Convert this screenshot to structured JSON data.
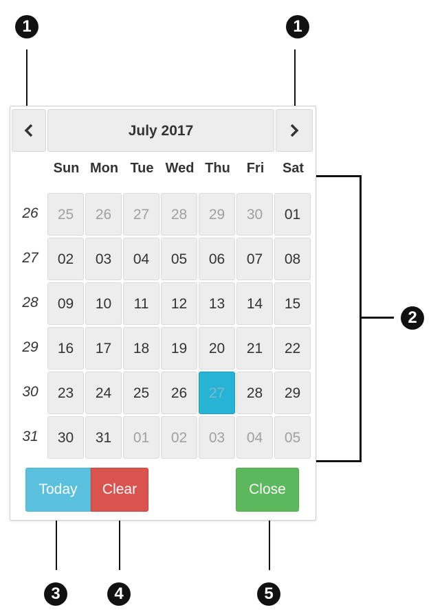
{
  "callouts": {
    "prev": "1",
    "next": "1",
    "grid": "2",
    "today": "3",
    "clear": "4",
    "close": "5"
  },
  "picker": {
    "title": "July 2017",
    "prev_icon": "chevron-left-icon",
    "next_icon": "chevron-right-icon",
    "weekdays": [
      "Sun",
      "Mon",
      "Tue",
      "Wed",
      "Thu",
      "Fri",
      "Sat"
    ],
    "weeks": [
      {
        "num": "26",
        "days": [
          "25",
          "26",
          "27",
          "28",
          "29",
          "30",
          "01"
        ]
      },
      {
        "num": "27",
        "days": [
          "02",
          "03",
          "04",
          "05",
          "06",
          "07",
          "08"
        ]
      },
      {
        "num": "28",
        "days": [
          "09",
          "10",
          "11",
          "12",
          "13",
          "14",
          "15"
        ]
      },
      {
        "num": "29",
        "days": [
          "16",
          "17",
          "18",
          "19",
          "20",
          "21",
          "22"
        ]
      },
      {
        "num": "30",
        "days": [
          "23",
          "24",
          "25",
          "26",
          "27",
          "28",
          "29"
        ]
      },
      {
        "num": "31",
        "days": [
          "30",
          "31",
          "01",
          "02",
          "03",
          "04",
          "05"
        ]
      }
    ],
    "muted_days": [
      [
        0,
        0
      ],
      [
        0,
        1
      ],
      [
        0,
        2
      ],
      [
        0,
        3
      ],
      [
        0,
        4
      ],
      [
        0,
        5
      ],
      [
        5,
        2
      ],
      [
        5,
        3
      ],
      [
        5,
        4
      ],
      [
        5,
        5
      ],
      [
        5,
        6
      ]
    ],
    "selected_day": [
      4,
      4
    ],
    "buttons": {
      "today": "Today",
      "clear": "Clear",
      "close": "Close"
    }
  },
  "colors": {
    "today_button": "#5bc0de",
    "clear_button": "#d9534f",
    "close_button": "#5cb85c",
    "selected_day": "#26b3d6"
  }
}
